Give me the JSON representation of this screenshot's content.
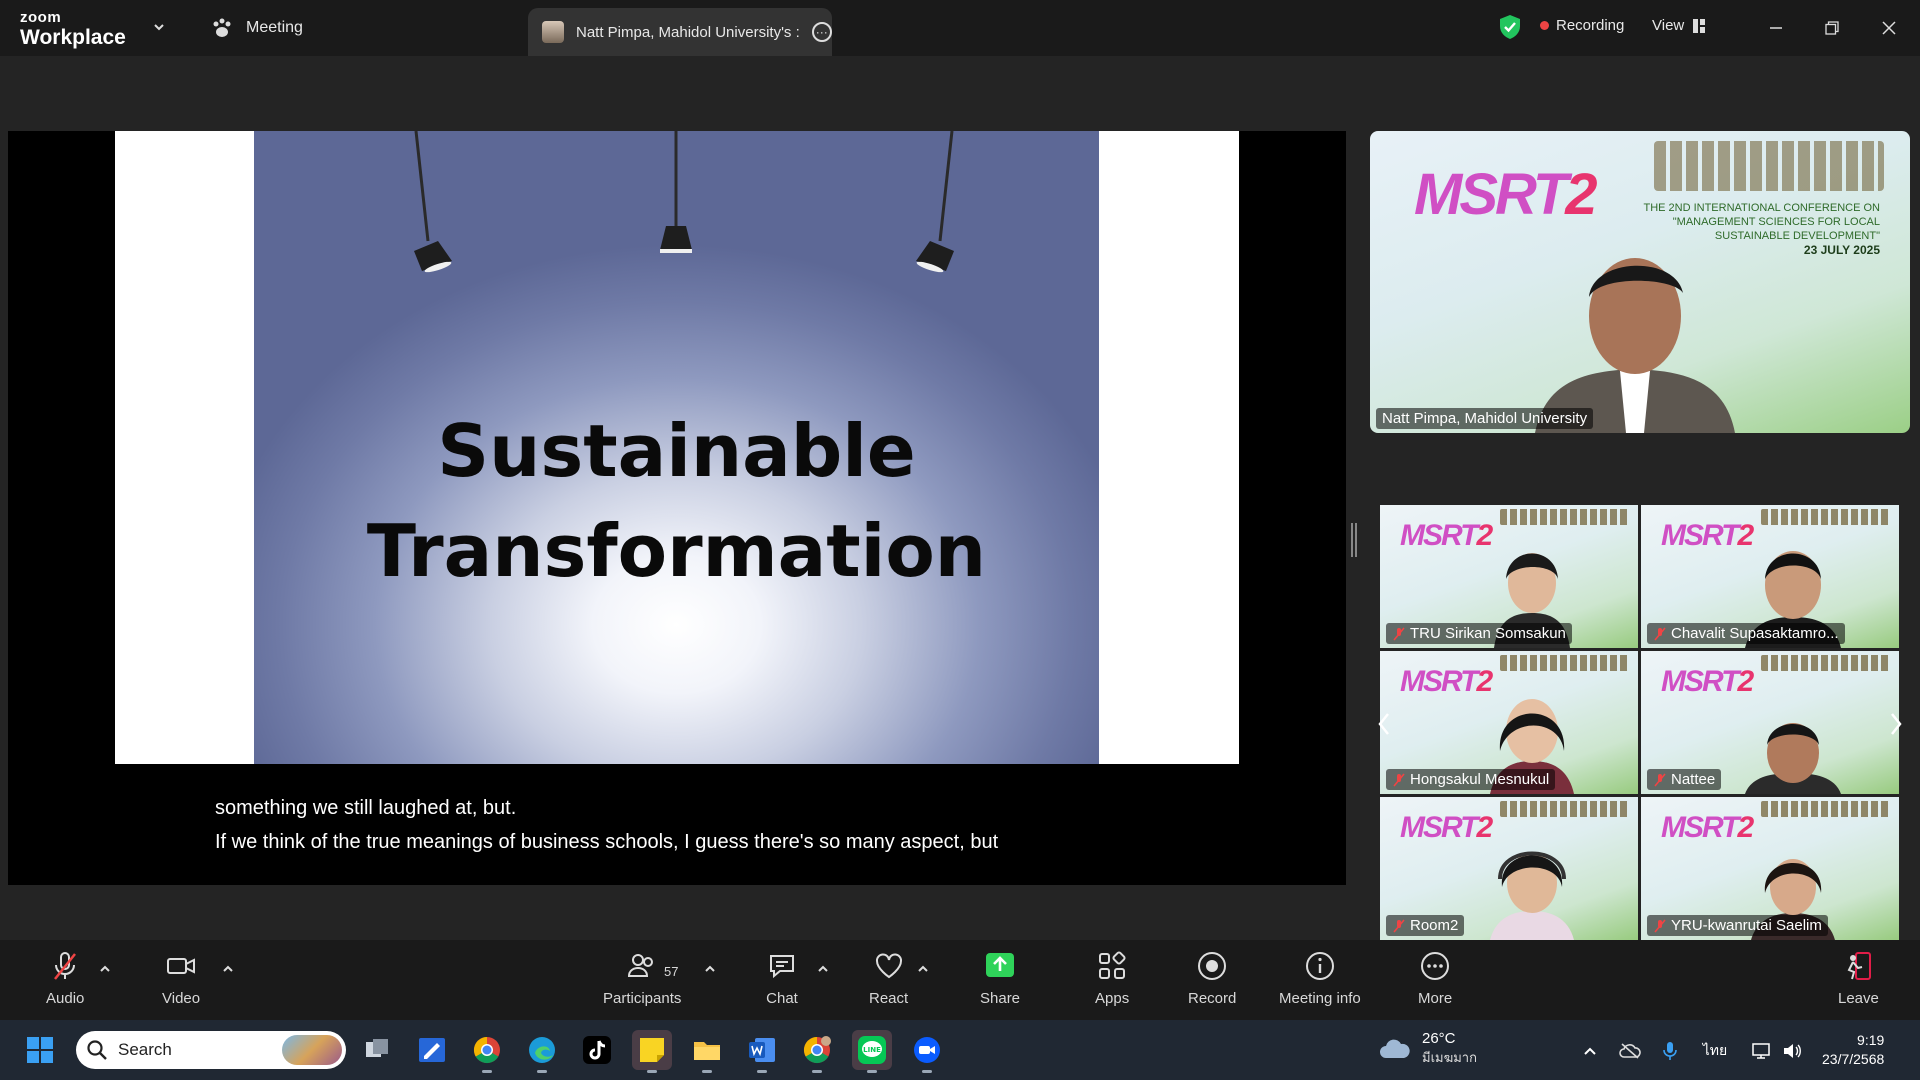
{
  "app": {
    "brand_small": "zoom",
    "brand_large": "Workplace"
  },
  "tabs": {
    "meeting_label": "Meeting",
    "active_label": "Natt Pimpa, Mahidol University's :"
  },
  "status": {
    "recording_label": "Recording",
    "view_label": "View"
  },
  "slide": {
    "line1": "Sustainable",
    "line2": "Transformation"
  },
  "captions": {
    "line1": "something we still laughed at, but.",
    "line2": "If we think of the true meanings of business schools, I guess there's so many aspect, but"
  },
  "speaker": {
    "name": "Natt Pimpa, Mahidol University",
    "logo": "MSRT2",
    "conf_lines": [
      "THE 2ND INTERNATIONAL CONFERENCE ON",
      "\"MANAGEMENT SCIENCES FOR LOCAL",
      "SUSTAINABLE DEVELOPMENT\"",
      "23 JULY 2025"
    ]
  },
  "gallery": [
    {
      "name": "TRU Sirikan Somsakun"
    },
    {
      "name": "Chavalit Supasaktamro..."
    },
    {
      "name": "Hongsakul Mesnukul"
    },
    {
      "name": "Nattee"
    },
    {
      "name": "Room2"
    },
    {
      "name": "YRU-kwanrutai Saelim"
    }
  ],
  "toolbar": {
    "audio": "Audio",
    "video": "Video",
    "participants": "Participants",
    "participants_count": "57",
    "chat": "Chat",
    "react": "React",
    "share": "Share",
    "apps": "Apps",
    "record": "Record",
    "meeting_info": "Meeting info",
    "more": "More",
    "leave": "Leave"
  },
  "taskbar": {
    "search_label": "Search",
    "temperature": "26°C",
    "weather_desc": "มีเมฆมาก",
    "language": "ไทย",
    "time": "9:19",
    "date": "23/7/2568"
  },
  "colors": {
    "share_green": "#2fd35a",
    "recording_red": "#ef4444",
    "shield_green": "#22c55e",
    "leave_red": "#e11d48"
  }
}
